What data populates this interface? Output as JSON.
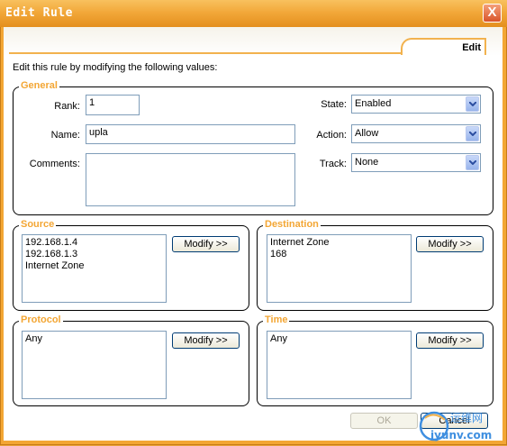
{
  "window": {
    "title": "Edit Rule",
    "close_glyph": "X"
  },
  "tab": {
    "label": "Edit"
  },
  "intro": "Edit this rule by modifying the following values:",
  "general": {
    "legend": "General",
    "rank_label": "Rank:",
    "rank_value": "1",
    "name_label": "Name:",
    "name_value": "upla",
    "comments_label": "Comments:",
    "comments_value": "",
    "state_label": "State:",
    "state_value": "Enabled",
    "action_label": "Action:",
    "action_value": "Allow",
    "track_label": "Track:",
    "track_value": "None"
  },
  "source": {
    "legend": "Source",
    "items": [
      "192.168.1.4",
      "192.168.1.3",
      "Internet Zone"
    ],
    "modify_label": "Modify >>"
  },
  "destination": {
    "legend": "Destination",
    "items": [
      "Internet Zone",
      "168"
    ],
    "modify_label": "Modify >>"
  },
  "protocol": {
    "legend": "Protocol",
    "items": [
      "Any"
    ],
    "modify_label": "Modify >>"
  },
  "time": {
    "legend": "Time",
    "items": [
      "Any"
    ],
    "modify_label": "Modify >>"
  },
  "footer": {
    "ok_label": "OK",
    "cancel_label": "Cancel"
  },
  "watermark": {
    "line1": "运维网",
    "line2": "iyunv.com"
  },
  "colors": {
    "frame": "#f3a634",
    "legend_text": "#f3a634",
    "tab_border": "#f2b24e",
    "input_border": "#7f9db9",
    "button_border": "#003c74"
  }
}
